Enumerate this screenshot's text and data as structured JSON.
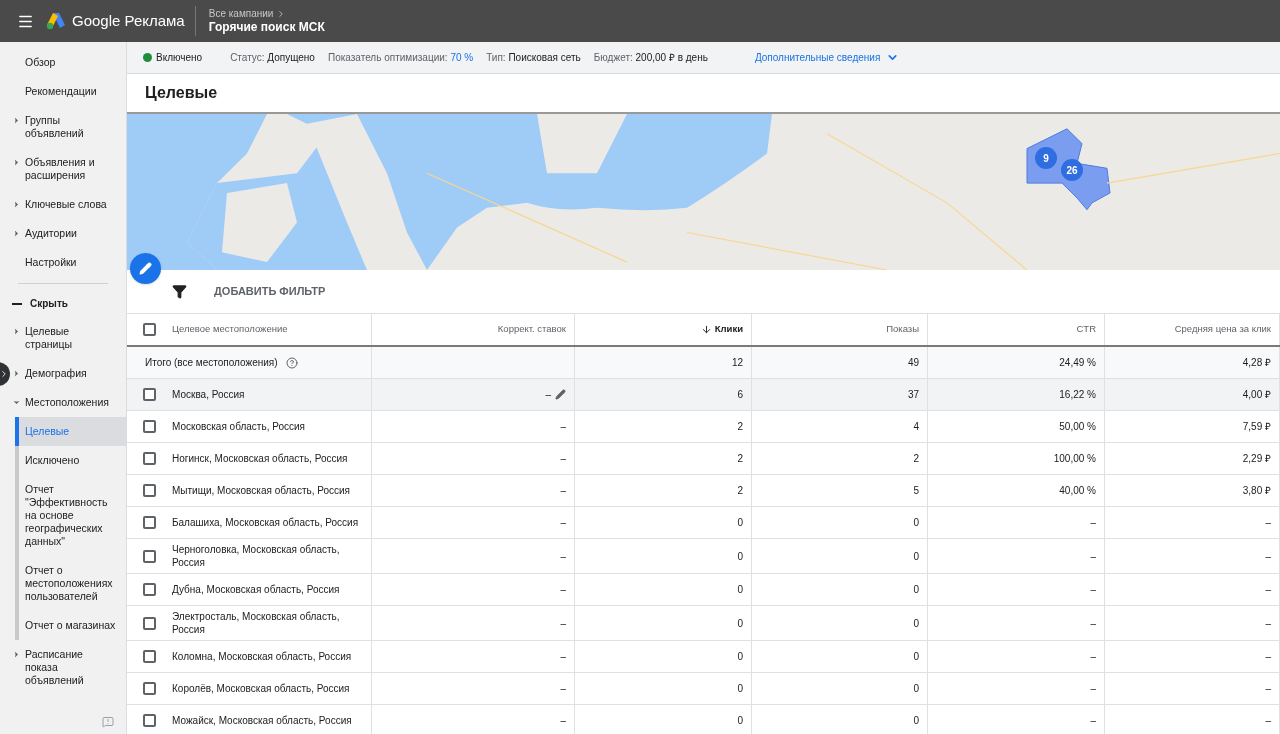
{
  "header": {
    "product": "Google Реклама",
    "breadcrumb": "Все кампании",
    "campaign": "Горячие поиск МСК"
  },
  "sidebar": {
    "items": [
      {
        "label": "Обзор",
        "expandable": false,
        "selected": false
      },
      {
        "label": "Рекомендации",
        "expandable": false,
        "selected": false
      },
      {
        "label": "Группы объявлений",
        "expandable": true,
        "expanded": false,
        "selected": false
      },
      {
        "label": "Объявления и расширения",
        "expandable": true,
        "expanded": false,
        "selected": false
      },
      {
        "label": "Ключевые слова",
        "expandable": true,
        "expanded": false,
        "selected": false
      },
      {
        "label": "Аудитории",
        "expandable": true,
        "expanded": false,
        "selected": false
      },
      {
        "label": "Настройки",
        "expandable": false,
        "selected": false
      }
    ],
    "toggle": "Скрыть",
    "more_items": [
      {
        "label": "Целевые страницы",
        "expandable": true,
        "expanded": false,
        "selected": false
      },
      {
        "label": "Демография",
        "expandable": true,
        "expanded": false,
        "selected": false
      },
      {
        "label": "Местоположения",
        "expandable": true,
        "expanded": true,
        "selected": false,
        "children": [
          {
            "label": "Целевые",
            "selected": true
          },
          {
            "label": "Исключено",
            "selected": false
          },
          {
            "label": "Отчет \"Эффективность на основе географических данных\"",
            "selected": false
          },
          {
            "label": "Отчет о местоположениях пользователей",
            "selected": false
          },
          {
            "label": "Отчет о магазинах",
            "selected": false
          }
        ]
      },
      {
        "label": "Расписание показа объявлений",
        "expandable": true,
        "expanded": false,
        "selected": false
      }
    ]
  },
  "status_bar": {
    "enabled": true,
    "state": "Включено",
    "items": [
      {
        "label": "Статус:",
        "value": "Допущено",
        "highlight": false
      },
      {
        "label": "Показатель оптимизации:",
        "value": "70 %",
        "highlight": true
      },
      {
        "label": "Тип:",
        "value": "Поисковая сеть",
        "highlight": false
      },
      {
        "label": "Бюджет:",
        "value": "200,00 ₽ в день",
        "highlight": false
      }
    ],
    "details_link": "Дополнительные сведения"
  },
  "page_title": "Целевые",
  "map": {
    "markers": [
      "9",
      "26"
    ]
  },
  "filter": {
    "label": "ДОБАВИТЬ ФИЛЬТР"
  },
  "table": {
    "select_all_checked": false,
    "columns": [
      {
        "label": "Целевое местоположение",
        "sorted": false
      },
      {
        "label": "Коррект. ставок",
        "sorted": false
      },
      {
        "label": "Клики",
        "sorted": true
      },
      {
        "label": "Показы",
        "sorted": false
      },
      {
        "label": "CTR",
        "sorted": false
      },
      {
        "label": "Средняя цена за клик",
        "sorted": false
      }
    ],
    "total": {
      "label": "Итого (все местоположения)",
      "cells": [
        "",
        "12",
        "49",
        "24,49 %",
        "4,28 ₽"
      ]
    },
    "rows": [
      {
        "checked": false,
        "hovered": true,
        "cells": [
          "Москва, Россия",
          "–",
          "6",
          "37",
          "16,22 %",
          "4,00 ₽"
        ]
      },
      {
        "checked": false,
        "hovered": false,
        "cells": [
          "Московская область, Россия",
          "–",
          "2",
          "4",
          "50,00 %",
          "7,59 ₽"
        ]
      },
      {
        "checked": false,
        "hovered": false,
        "cells": [
          "Ногинск, Московская область, Россия",
          "–",
          "2",
          "2",
          "100,00 %",
          "2,29 ₽"
        ]
      },
      {
        "checked": false,
        "hovered": false,
        "cells": [
          "Мытищи, Московская область, Россия",
          "–",
          "2",
          "5",
          "40,00 %",
          "3,80 ₽"
        ]
      },
      {
        "checked": false,
        "hovered": false,
        "cells": [
          "Балашиха, Московская область, Россия",
          "–",
          "0",
          "0",
          "–",
          "–"
        ]
      },
      {
        "checked": false,
        "hovered": false,
        "cells": [
          "Черноголовка, Московская область, Россия",
          "–",
          "0",
          "0",
          "–",
          "–"
        ]
      },
      {
        "checked": false,
        "hovered": false,
        "cells": [
          "Дубна, Московская область, Россия",
          "–",
          "0",
          "0",
          "–",
          "–"
        ]
      },
      {
        "checked": false,
        "hovered": false,
        "cells": [
          "Электросталь, Московская область, Россия",
          "–",
          "0",
          "0",
          "–",
          "–"
        ]
      },
      {
        "checked": false,
        "hovered": false,
        "cells": [
          "Коломна, Московская область, Россия",
          "–",
          "0",
          "0",
          "–",
          "–"
        ]
      },
      {
        "checked": false,
        "hovered": false,
        "cells": [
          "Королёв, Московская область, Россия",
          "–",
          "0",
          "0",
          "–",
          "–"
        ]
      },
      {
        "checked": false,
        "hovered": false,
        "cells": [
          "Можайск, Московская область, Россия",
          "–",
          "0",
          "0",
          "–",
          "–"
        ]
      }
    ]
  }
}
